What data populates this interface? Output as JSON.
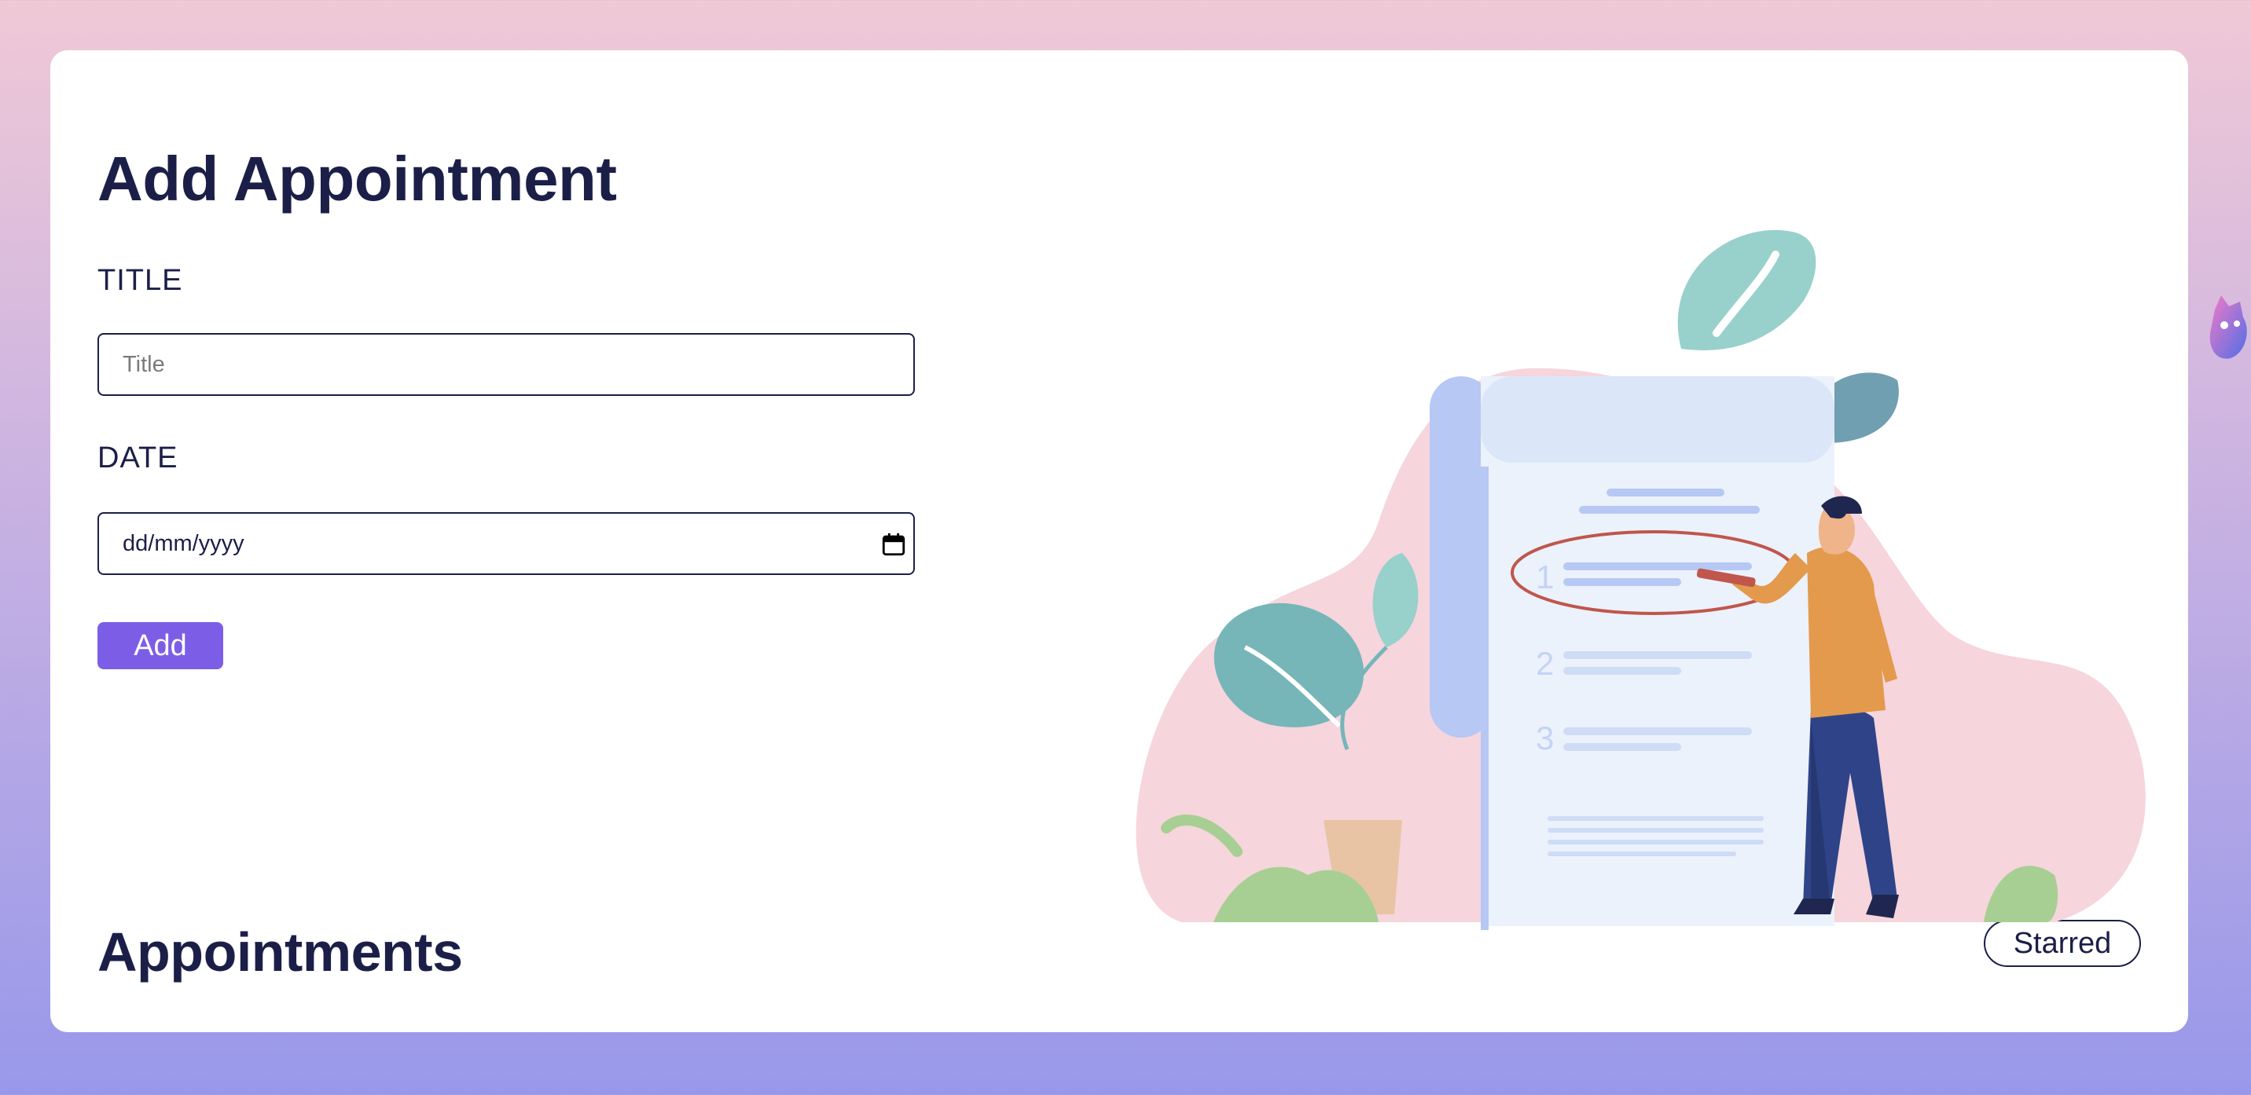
{
  "form": {
    "title": "Add Appointment",
    "title_label": "TITLE",
    "title_placeholder": "Title",
    "date_label": "DATE",
    "date_value": "dd/mm/yyyy",
    "add_label": "Add"
  },
  "list": {
    "title": "Appointments",
    "starred_label": "Starred"
  },
  "illustration": {
    "numbers": [
      "1",
      "2",
      "3"
    ]
  },
  "colors": {
    "primary_text": "#1b1f48",
    "accent": "#7c5ee6",
    "background_top": "#f0c9d6",
    "background_bottom": "#9898ea"
  },
  "icons": {
    "date_picker": "calendar-icon",
    "floating": "mascot-icon"
  }
}
